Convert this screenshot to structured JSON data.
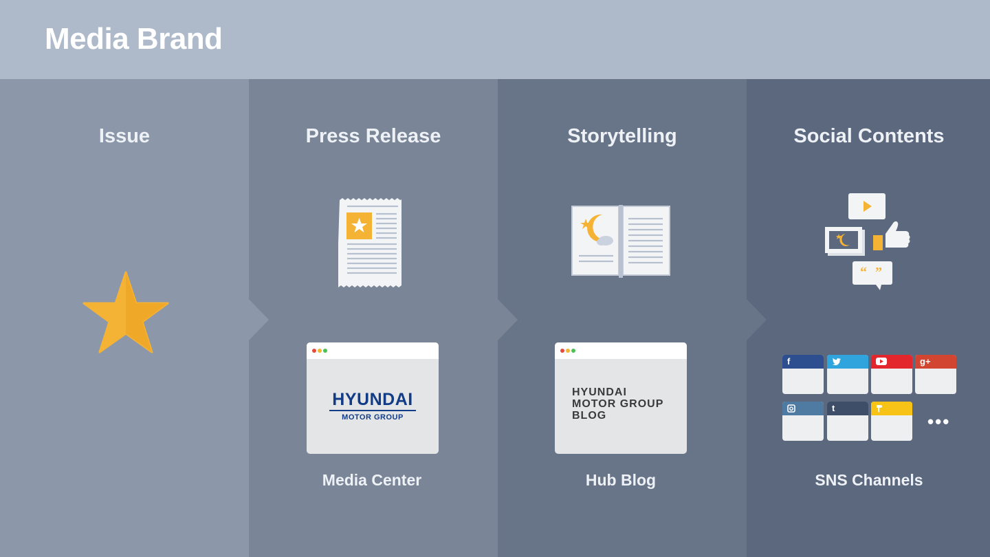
{
  "header": {
    "title": "Media Brand"
  },
  "columns": [
    {
      "title": "Issue",
      "caption": ""
    },
    {
      "title": "Press Release",
      "caption": "Media Center"
    },
    {
      "title": "Storytelling",
      "caption": "Hub Blog"
    },
    {
      "title": "Social Contents",
      "caption": "SNS Channels"
    }
  ],
  "media_center_logo": {
    "line1": "HYUNDAI",
    "line2": "MOTOR GROUP"
  },
  "hub_blog_logo": {
    "line1": "HYUNDAI",
    "line2": "MOTOR GROUP",
    "line3": "BLOG"
  },
  "sns_tiles": [
    {
      "icon": "facebook-icon",
      "glyph": "f",
      "color": "#2d4f8f"
    },
    {
      "icon": "twitter-icon",
      "glyph": "t",
      "color": "#2fa4dd"
    },
    {
      "icon": "youtube-icon",
      "glyph": "",
      "color": "#e3262c"
    },
    {
      "icon": "google-plus-icon",
      "glyph": "g+",
      "color": "#d24530"
    },
    {
      "icon": "instagram-icon",
      "glyph": "",
      "color": "#4f7ba3"
    },
    {
      "icon": "tumblr-icon",
      "glyph": "t",
      "color": "#3e4e69"
    },
    {
      "icon": "kakao-story-icon",
      "glyph": "",
      "color": "#f8c317"
    }
  ],
  "sns_more": "•••",
  "colors": {
    "header_bg": "#aeb9c9",
    "col1_bg": "#8c98a9",
    "col2_bg": "#7a8698",
    "col3_bg": "#687589",
    "col4_bg": "#5b687e",
    "accent": "#f5b335"
  }
}
